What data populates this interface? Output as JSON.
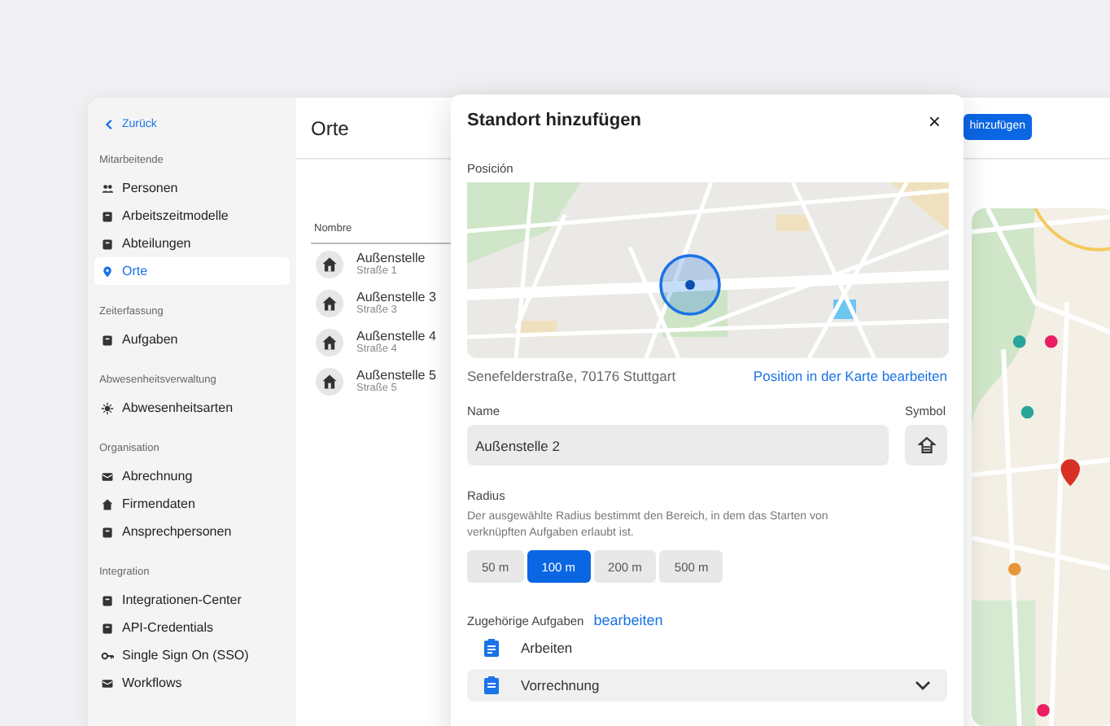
{
  "sidebar": {
    "back": "Zurück",
    "sections": [
      {
        "title": "Mitarbeitende",
        "items": [
          {
            "label": "Personen",
            "selected": false
          },
          {
            "label": "Arbeitszeitmodelle",
            "selected": false
          },
          {
            "label": "Abteilungen",
            "selected": false
          },
          {
            "label": "Orte",
            "selected": true
          }
        ]
      },
      {
        "title": "Zeiterfassung",
        "items": [
          {
            "label": "Aufgaben",
            "selected": false
          }
        ]
      },
      {
        "title": "Abwesenheitsverwaltung",
        "items": [
          {
            "label": "Abwesenheitsarten",
            "selected": false
          }
        ]
      },
      {
        "title": "Organisation",
        "items": [
          {
            "label": "Abrechnung",
            "selected": false
          },
          {
            "label": "Firmendaten",
            "selected": false
          },
          {
            "label": "Ansprechpersonen",
            "selected": false
          }
        ]
      },
      {
        "title": "Integration",
        "items": [
          {
            "label": "Integrationen-Center",
            "selected": false
          },
          {
            "label": "API-Credentials",
            "selected": false
          },
          {
            "label": "Single Sign On (SSO)",
            "selected": false
          },
          {
            "label": "Workflows",
            "selected": false
          }
        ]
      }
    ]
  },
  "page": {
    "title": "Orte",
    "add_button": "hinzufügen",
    "table": {
      "columns": [
        "Nombre"
      ],
      "rows": [
        {
          "name": "Außenstelle",
          "street": "Straße 1"
        },
        {
          "name": "Außenstelle 3",
          "street": "Straße 3"
        },
        {
          "name": "Außenstelle 4",
          "street": "Straße 4"
        },
        {
          "name": "Außenstelle 5",
          "street": "Straße 5"
        }
      ]
    }
  },
  "dialog": {
    "title": "Standort hinzufügen",
    "close": "×",
    "position_label": "Posición",
    "address": "Senefelderstraße, 70176 Stuttgart",
    "edit_position_link": "Position in der Karte bearbeiten",
    "name_label": "Name",
    "name_value": "Außenstelle 2",
    "symbol_label": "Symbol",
    "radius_label": "Radius",
    "radius_description": "Der ausgewählte Radius bestimmt den Bereich, in dem das Starten von verknüpften Aufgaben erlaubt ist.",
    "radius_options": [
      {
        "label": "50 m",
        "selected": false
      },
      {
        "label": "100 m",
        "selected": true
      },
      {
        "label": "200 m",
        "selected": false
      },
      {
        "label": "500 m",
        "selected": false
      }
    ],
    "tasks_label": "Zugehörige Aufgaben",
    "tasks_edit_link": "bearbeiten",
    "tasks": [
      {
        "label": "Arbeiten",
        "kind": "plain"
      },
      {
        "label": "Vorrechnung",
        "kind": "dropdown"
      }
    ]
  }
}
